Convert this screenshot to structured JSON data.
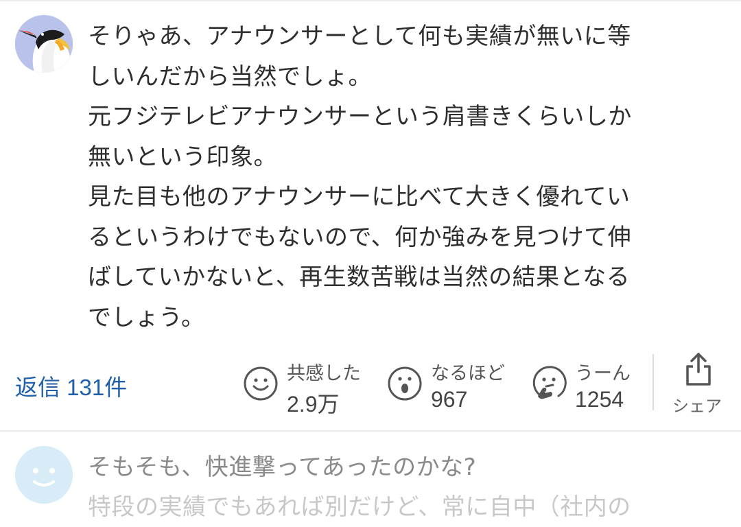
{
  "comment_1": {
    "avatar_icon": "penguin-avatar",
    "lines": [
      "そりゃあ、アナウンサーとして何も実績が無いに等",
      "しいんだから当然でしょ。",
      "元フジテレビアナウンサーという肩書きくらいしか",
      "無いという印象。",
      "見た目も他のアナウンサーに比べて大きく優れてい",
      "るというわけでもないので、何か強みを見つけて伸",
      "ばしていかないと、再生数苦戦は当然の結果となる",
      "でしょう。"
    ],
    "reply_label": "返信 131件",
    "reactions": [
      {
        "icon": "smile-face-icon",
        "label": "共感した",
        "count": "2.9万"
      },
      {
        "icon": "surprised-face-icon",
        "label": "なるほど",
        "count": "967"
      },
      {
        "icon": "thinking-face-icon",
        "label": "うーん",
        "count": "1254"
      }
    ],
    "share_icon": "share-icon",
    "share_label": "シェア"
  },
  "comment_2": {
    "avatar_icon": "default-smile-avatar",
    "lines": [
      "そもそも、快進撃ってあったのかな?",
      "特段の実績でもあれば別だけど、常に自中（社内の"
    ]
  },
  "colors": {
    "link": "#1f5ea8",
    "text": "#2e2e2e",
    "divider": "#ececec",
    "avatar_bg_1": "#b9c2ea",
    "avatar_bg_2": "#d7ecf7"
  }
}
